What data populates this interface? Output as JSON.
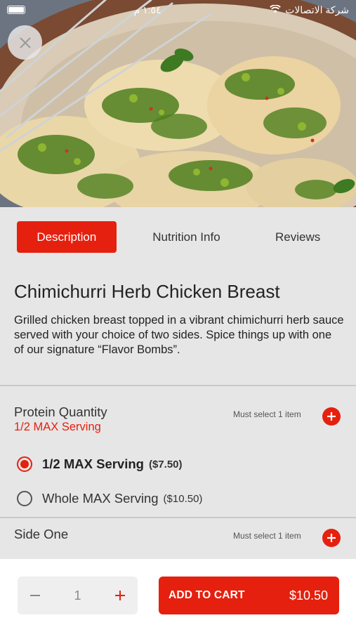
{
  "status_bar": {
    "time": "١:٥٤ م",
    "carrier": "شركة الاتصالات"
  },
  "tabs": [
    {
      "label": "Description",
      "active": true
    },
    {
      "label": "Nutrition Info",
      "active": false
    },
    {
      "label": "Reviews",
      "active": false
    }
  ],
  "product": {
    "name": "Chimichurri Herb Chicken Breast",
    "description": "Grilled chicken breast topped in a vibrant chimichurri herb sauce served with your choice of two sides. Spice things up with one of our signature “Flavor Bombs”."
  },
  "sections": [
    {
      "title": "Protein Quantity",
      "selected": "1/2 MAX Serving",
      "requirement": "Must select 1 item",
      "options": [
        {
          "name": "1/2 MAX Serving",
          "price": "($7.50)",
          "selected": true
        },
        {
          "name": "Whole MAX Serving",
          "price": "($10.50)",
          "selected": false
        }
      ]
    },
    {
      "title": "Side One",
      "requirement": "Must select 1 item"
    }
  ],
  "cart": {
    "quantity": "1",
    "button_label": "ADD TO CART",
    "total": "$10.50"
  },
  "colors": {
    "accent": "#e5200e",
    "background": "#e6e6e6"
  },
  "icons": {
    "close": "close-icon",
    "add": "plus-icon",
    "minus": "minus-icon",
    "wifi": "wifi-icon",
    "battery": "battery-icon"
  }
}
